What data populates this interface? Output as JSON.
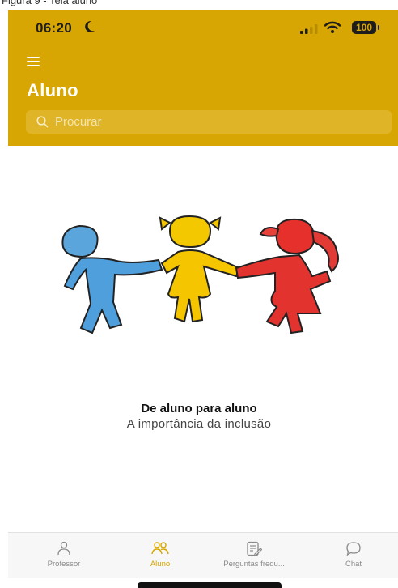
{
  "caption": "Figura 9 - Tela aluno",
  "status_bar": {
    "time": "06:20",
    "battery": "100",
    "icons": [
      "moon-icon",
      "signal-icon",
      "wifi-icon",
      "battery-icon"
    ]
  },
  "header": {
    "title": "Aluno",
    "search_placeholder": "Procurar"
  },
  "content": {
    "headline": "De aluno para aluno",
    "subtitle": "A importância da inclusão"
  },
  "tabs": [
    {
      "label": "Professor",
      "icon": "person-icon",
      "active": false
    },
    {
      "label": "Aluno",
      "icon": "group-icon",
      "active": true
    },
    {
      "label": "Perguntas frequ...",
      "icon": "faq-edit-icon",
      "active": false
    },
    {
      "label": "Chat",
      "icon": "chat-bubble-icon",
      "active": false
    }
  ],
  "colors": {
    "accent": "#d8a602",
    "search_bg": "#dfb427",
    "tab_inactive": "#8a8a8a"
  }
}
